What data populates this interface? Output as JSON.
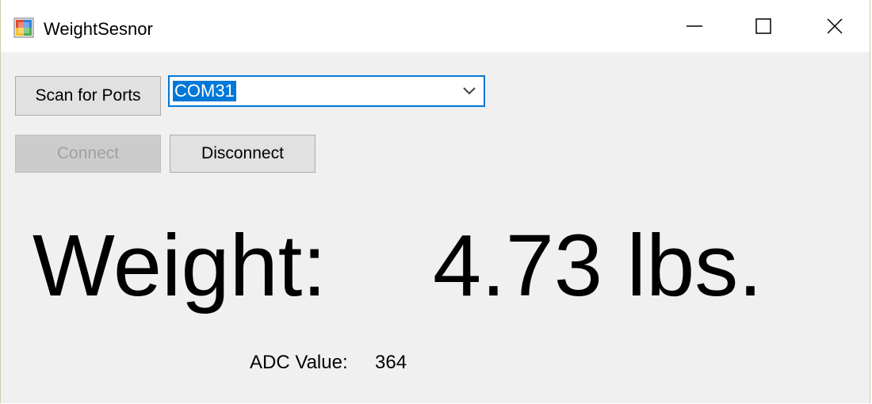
{
  "window": {
    "title": "WeightSesnor",
    "app_icon": "windows-forms-app-icon",
    "controls": {
      "minimize_icon": "minimize-icon",
      "maximize_icon": "maximize-icon",
      "close_icon": "close-icon"
    }
  },
  "toolbar": {
    "scan_label": "Scan for Ports",
    "connect_label": "Connect",
    "connect_enabled": false,
    "disconnect_label": "Disconnect",
    "disconnect_enabled": true
  },
  "port_select": {
    "selected": "COM31",
    "arrow_icon": "chevron-down-icon"
  },
  "readout": {
    "weight_label": "Weight:",
    "weight_value": "4.73 lbs.",
    "adc_label": "ADC Value:",
    "adc_value": "364"
  },
  "colors": {
    "accent": "#0078d7",
    "window_bg": "#f0f0f0",
    "button_bg": "#e1e1e1",
    "disabled_bg": "#cccccc",
    "disabled_text": "#a0a0a0"
  }
}
